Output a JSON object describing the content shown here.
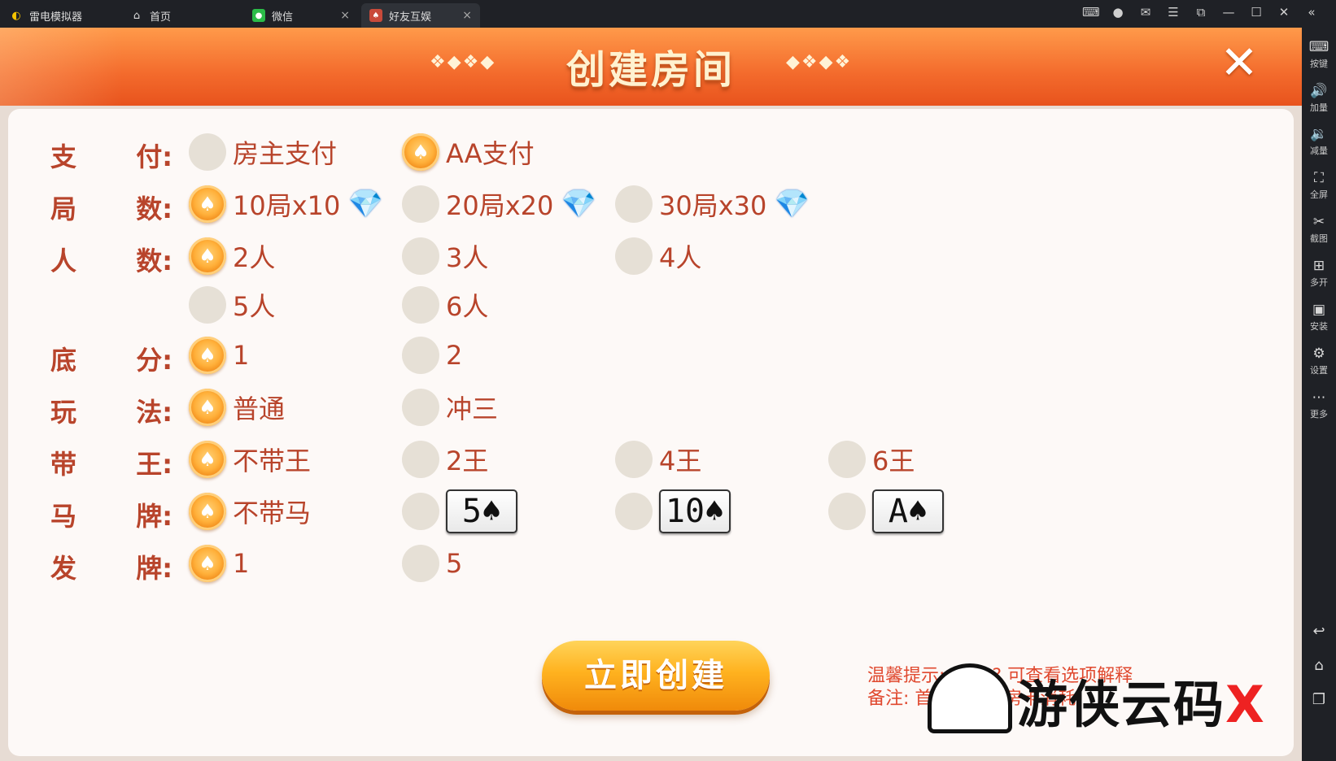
{
  "topbar": {
    "tabs": [
      {
        "label": "雷电模拟器",
        "icon": "ldplayer-logo-icon"
      },
      {
        "label": "首页",
        "icon": "home-icon"
      },
      {
        "label": "微信",
        "icon": "wechat-icon"
      },
      {
        "label": "好友互娱",
        "icon": "game-app-icon"
      }
    ],
    "close_glyph": "×"
  },
  "sidebar": {
    "items": [
      {
        "label": "按键",
        "icon": "keyboard-icon"
      },
      {
        "label": "加量",
        "icon": "volume-up-icon"
      },
      {
        "label": "减量",
        "icon": "volume-down-icon"
      },
      {
        "label": "全屏",
        "icon": "fullscreen-icon"
      },
      {
        "label": "截图",
        "icon": "scissors-icon"
      },
      {
        "label": "多开",
        "icon": "multi-instance-icon"
      },
      {
        "label": "安装",
        "icon": "apk-install-icon"
      },
      {
        "label": "设置",
        "icon": "settings-icon"
      },
      {
        "label": "更多",
        "icon": "more-icon"
      }
    ]
  },
  "dialog": {
    "title": "创建房间",
    "deco_left": "❖◆❖◆",
    "deco_right": "◆❖◆❖",
    "rows": {
      "pay": {
        "label": [
          "支",
          "付:"
        ],
        "options": [
          "房主支付",
          "AA支付"
        ],
        "selected": 1
      },
      "rounds": {
        "label": [
          "局",
          "数:"
        ],
        "options": [
          "10局x10",
          "20局x20",
          "30局x30"
        ],
        "selected": 0
      },
      "players": {
        "label": [
          "人",
          "数:"
        ],
        "options": [
          "2人",
          "3人",
          "4人",
          "5人",
          "6人"
        ],
        "selected": 0
      },
      "base": {
        "label": [
          "底",
          "分:"
        ],
        "options": [
          "1",
          "2"
        ],
        "selected": 0
      },
      "mode": {
        "label": [
          "玩",
          "法:"
        ],
        "options": [
          "普通",
          "冲三"
        ],
        "selected": 0
      },
      "kings": {
        "label": [
          "带",
          "王:"
        ],
        "options": [
          "不带王",
          "2王",
          "4王",
          "6王"
        ],
        "selected": 0
      },
      "horse": {
        "label": [
          "马",
          "牌:"
        ],
        "options": [
          "不带马",
          "5♠",
          "10♠",
          "A♠"
        ],
        "selected": 0
      },
      "deal": {
        "label": [
          "发",
          "牌:"
        ],
        "options": [
          "1",
          "5"
        ],
        "selected": 0
      }
    },
    "create_button": "立即创建",
    "tip_line1": "温馨提示: 点击 ? 可查看选项解释",
    "tip_line2": "备注: 首局开始算房卡消耗",
    "watermark": "游侠云码",
    "watermark_x": "X"
  },
  "colors": {
    "header_orange": "#f36a2c",
    "label_red": "#b8442b",
    "button_gold": "#ffb21f",
    "tip_red": "#e0492f"
  }
}
